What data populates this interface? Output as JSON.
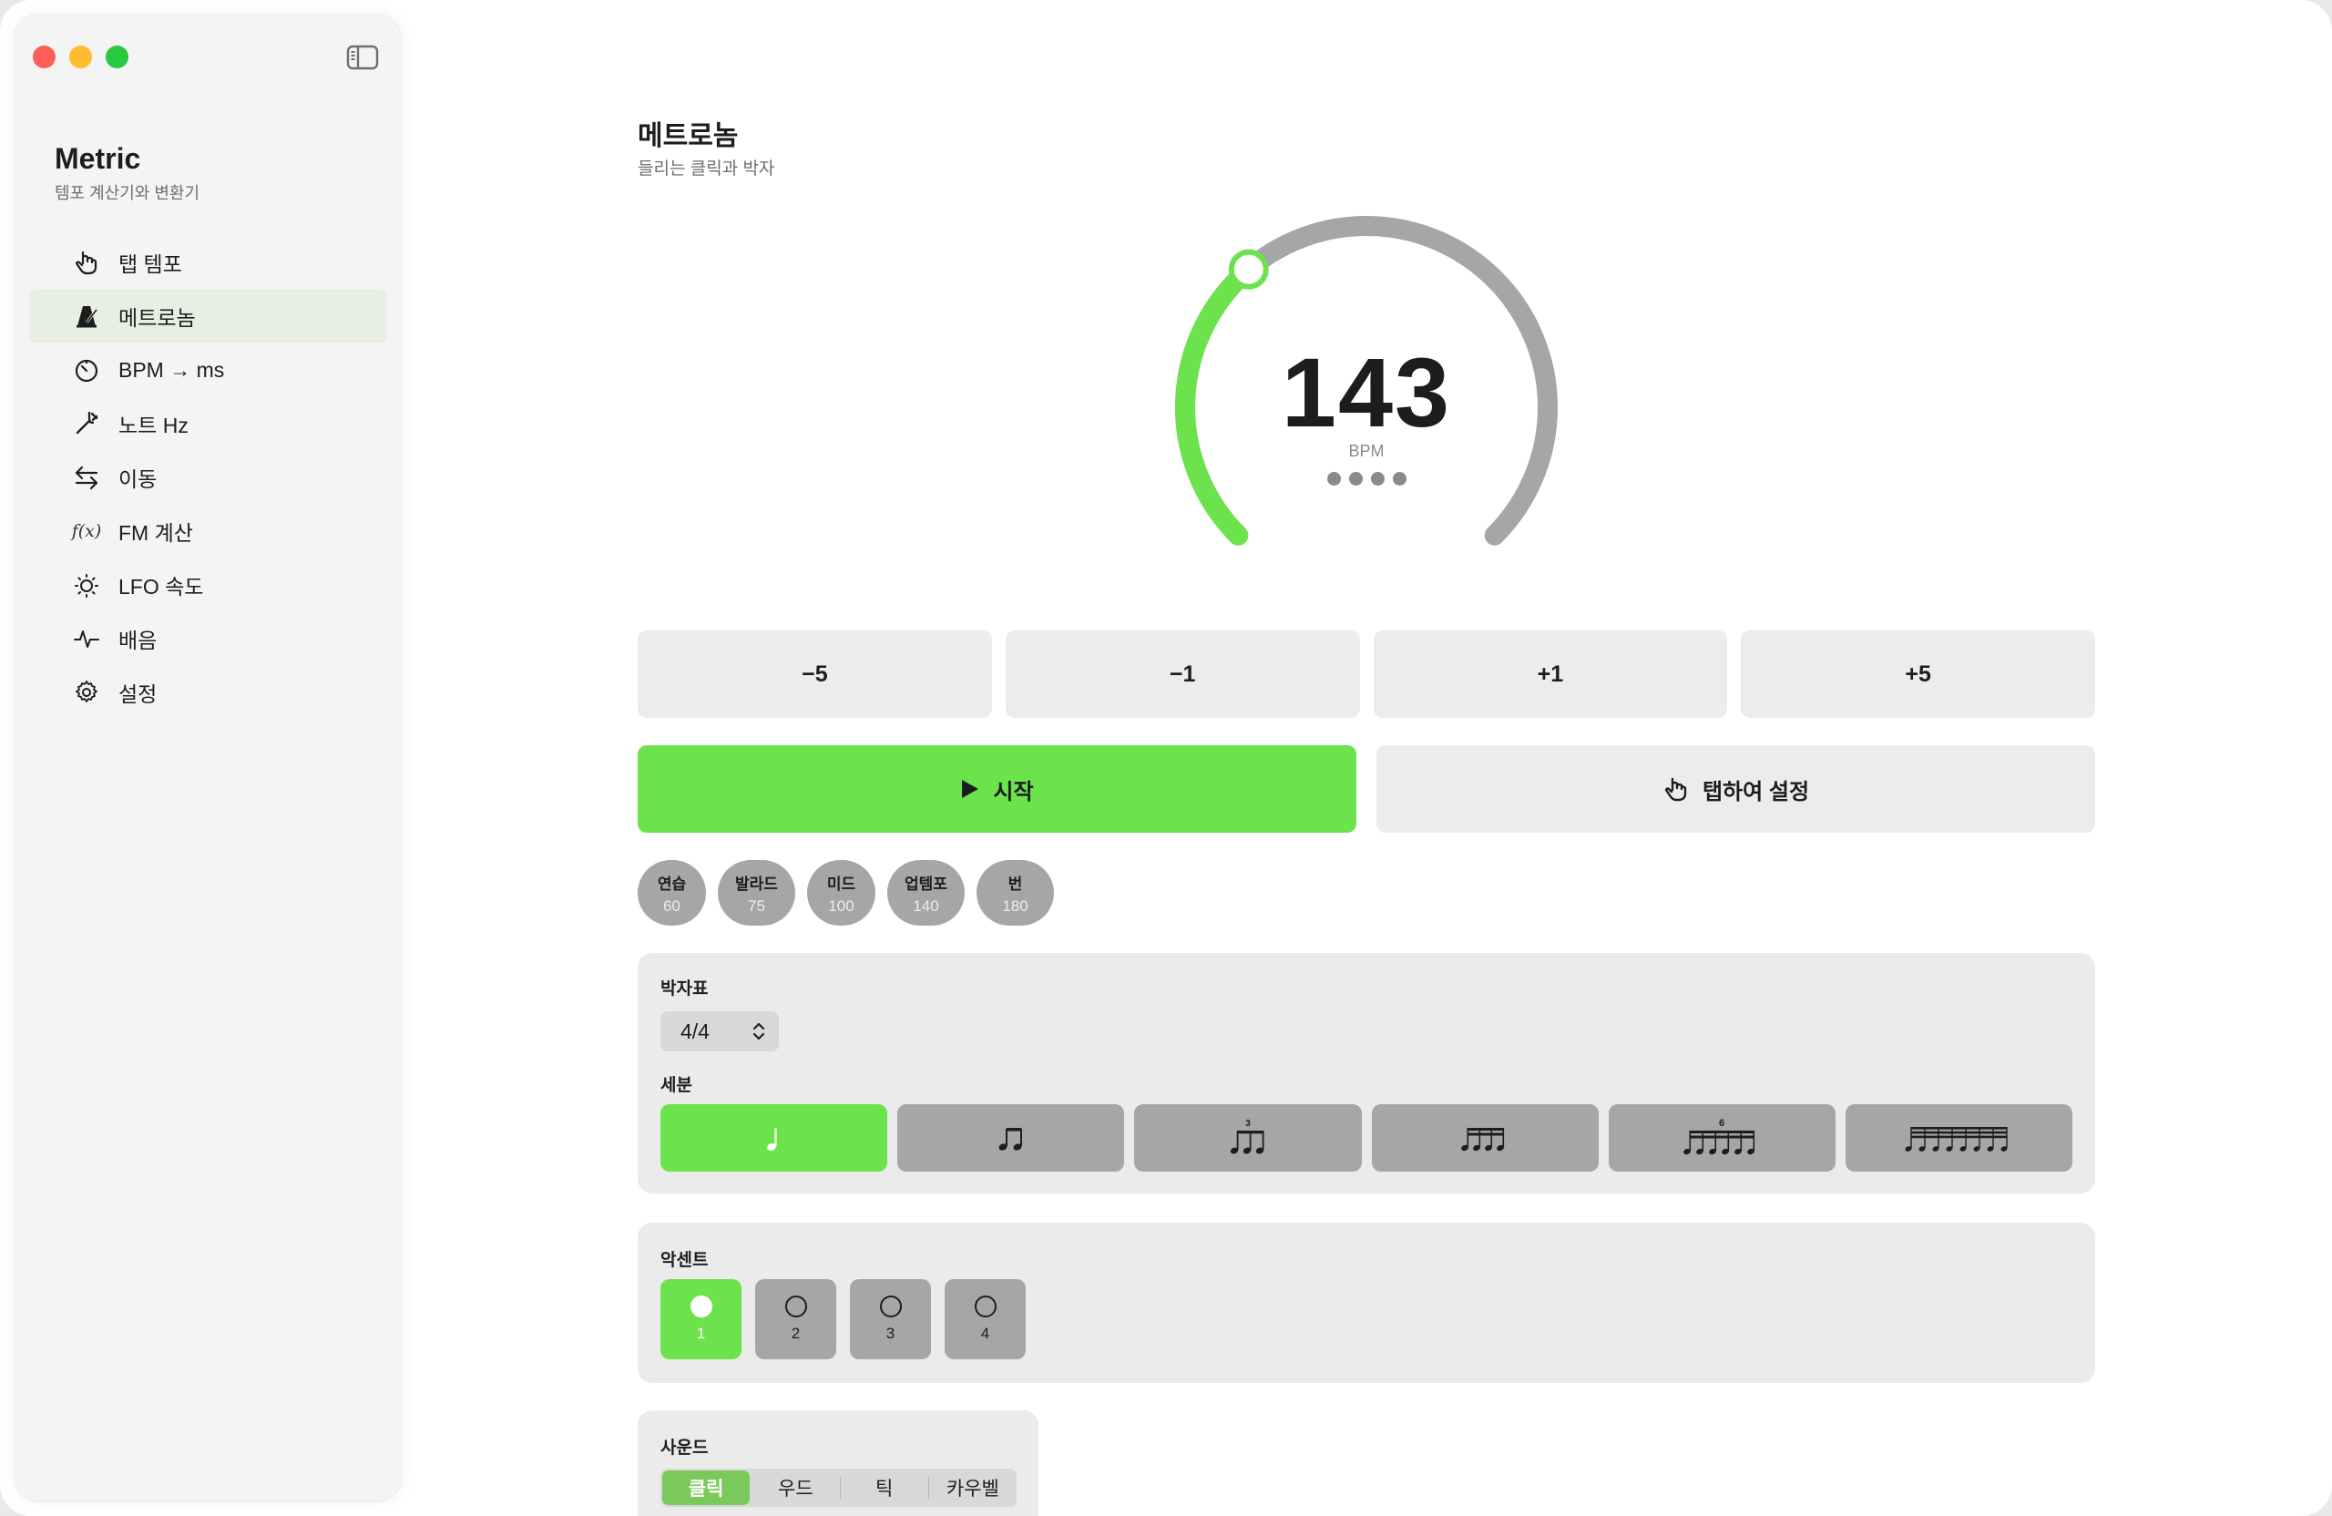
{
  "sidebar": {
    "app_name": "Metric",
    "app_subtitle": "템포 계산기와 변환기",
    "items": [
      {
        "label": "탭 템포",
        "icon": "tap-hand-icon"
      },
      {
        "label": "메트로놈",
        "icon": "metronome-icon",
        "active": true
      },
      {
        "label": "BPM → ms",
        "icon": "timer-icon"
      },
      {
        "label": "노트 Hz",
        "icon": "tuning-fork-icon"
      },
      {
        "label": "이동",
        "icon": "arrows-swap-icon"
      },
      {
        "label": "FM 계산",
        "icon": "function-icon",
        "icon_text": "f(x)"
      },
      {
        "label": "LFO 속도",
        "icon": "sun-dial-icon"
      },
      {
        "label": "배음",
        "icon": "waveform-icon"
      },
      {
        "label": "설정",
        "icon": "gear-icon"
      }
    ]
  },
  "main": {
    "title": "메트로놈",
    "subtitle": "들리는 클릭과 박자",
    "dial": {
      "bpm": "143",
      "unit": "BPM",
      "fill_fraction": 0.35,
      "beats": 4,
      "track_color": "#a6a6a6",
      "fill_color": "#6ce24c"
    },
    "steps": [
      "−5",
      "−1",
      "+1",
      "+5"
    ],
    "start_label": "시작",
    "tap_label": "탭하여 설정",
    "presets": [
      {
        "name": "연습",
        "bpm": "60"
      },
      {
        "name": "발라드",
        "bpm": "75"
      },
      {
        "name": "미드",
        "bpm": "100"
      },
      {
        "name": "업템포",
        "bpm": "140"
      },
      {
        "name": "번",
        "bpm": "180"
      }
    ],
    "meter": {
      "label": "박자표",
      "value": "4/4",
      "subdivision_label": "세분",
      "subdivisions": [
        {
          "name": "quarter-note-icon",
          "active": true
        },
        {
          "name": "eighth-notes-icon"
        },
        {
          "name": "triplet-icon",
          "tuplet": "3"
        },
        {
          "name": "sixteenth-notes-icon"
        },
        {
          "name": "sextuplet-icon",
          "tuplet": "6"
        },
        {
          "name": "thirty-second-notes-icon"
        }
      ]
    },
    "accent": {
      "label": "악센트",
      "beats": [
        "1",
        "2",
        "3",
        "4"
      ],
      "active_index": 0
    },
    "sound": {
      "label": "사운드",
      "options": [
        "클릭",
        "우드",
        "틱",
        "카우벨"
      ],
      "active_index": 0
    }
  },
  "colors": {
    "accent_green": "#6ce24c",
    "segment_green": "#7ac95a",
    "sidebar_active": "#e6efe1"
  }
}
